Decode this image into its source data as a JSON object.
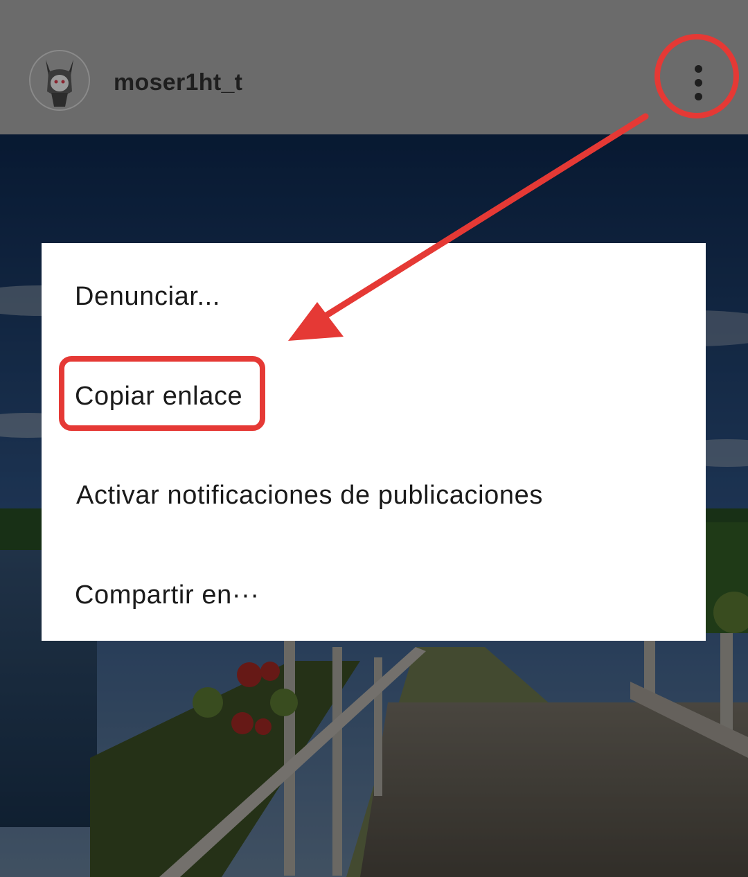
{
  "post": {
    "username": "moser1ht_t",
    "avatar_icon": "avatar-character-icon",
    "more_icon": "more-vertical-icon"
  },
  "menu": {
    "items": [
      {
        "label": "Denunciar..."
      },
      {
        "label": "Copiar enlace"
      },
      {
        "label": "Activar notificaciones de publicaciones"
      },
      {
        "label": "Compartir en···"
      }
    ]
  },
  "annotation": {
    "color": "#e53935"
  }
}
